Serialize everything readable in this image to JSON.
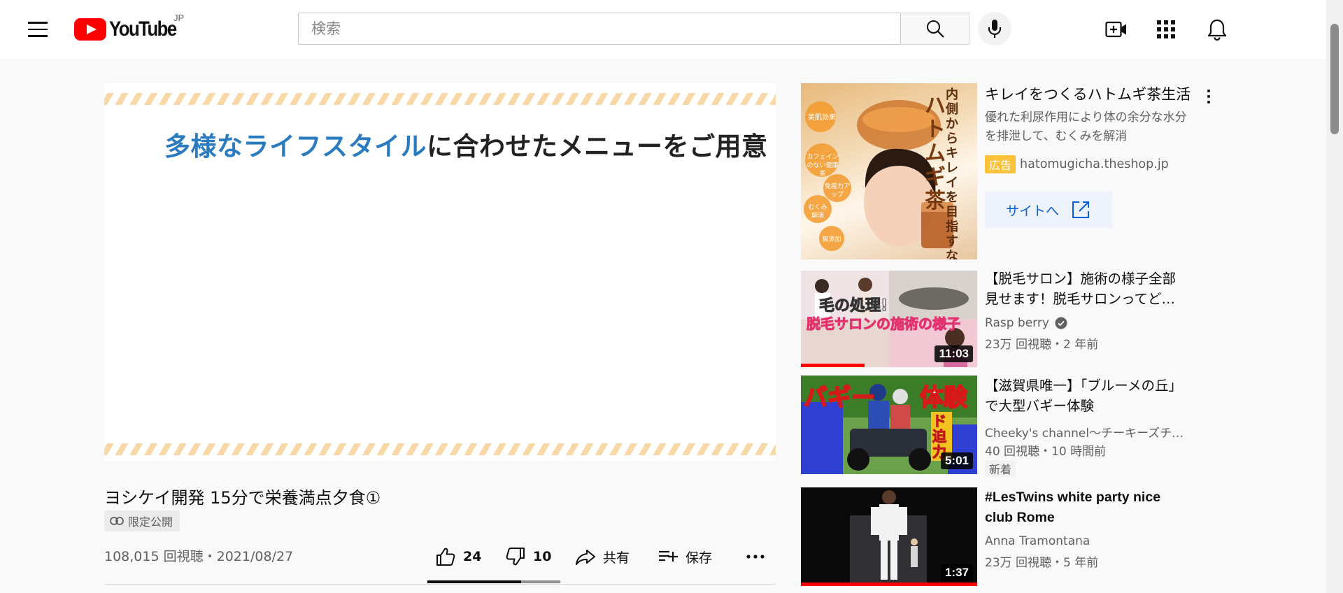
{
  "header": {
    "logo_text": "YouTube",
    "region": "JP",
    "search_placeholder": "検索",
    "icons": [
      "menu-icon",
      "search-icon",
      "microphone-icon",
      "create-video-icon",
      "apps-grid-icon",
      "notifications-bell-icon"
    ]
  },
  "player": {
    "slide_text_blue": "多様なライフスタイル",
    "slide_text_dark": "に合わせたメニューをご用意"
  },
  "video": {
    "title": "ヨシケイ開発 15分で栄養満点夕食①",
    "unlisted_label": "限定公開",
    "views_date": "108,015 回視聴・2021/08/27",
    "likes": "24",
    "dislikes": "10",
    "share_label": "共有",
    "save_label": "保存",
    "like_ratio": 0.706
  },
  "sidebar": {
    "ad": {
      "title": "キレイをつくるハトムギ茶生活",
      "description": "優れた利尿作用により体の余分な水分を排泄して、むくみを解消",
      "badge": "広告",
      "domain": "hatomugicha.theshop.jp",
      "button_label": "サイトへ",
      "thumb_text": "内側からキレイを目指すなら",
      "thumb_product": "ハトムギ茶",
      "thumb_bubbles": [
        "美肌効果",
        "カフェインのない健康茶",
        "免疫力アップ",
        "むくみ解消",
        "無添加"
      ]
    },
    "recommendations": [
      {
        "title": "【脱毛サロン】施術の様子全部見せます！脱毛サロンってど…",
        "channel": "Rasp berry",
        "verified": true,
        "meta": "23万 回視聴・2 年前",
        "duration": "11:03",
        "watched_fraction": 0.36,
        "thumb_text_1": "毛の処理!",
        "thumb_text_2": "脱毛サロンの施術の様子"
      },
      {
        "title": "【滋賀県唯一】「ブルーメの丘」で大型バギー体験",
        "channel": "Cheeky's channel〜チーキーズチャンネル〜",
        "verified": false,
        "meta": "40 回視聴・10 時間前",
        "badge": "新着",
        "duration": "5:01",
        "thumb_text_1": "バギー",
        "thumb_text_2": "体験",
        "thumb_text_3": "ド迫力"
      },
      {
        "title": "#LesTwins white party nice club Rome",
        "channel": "Anna Tramontana",
        "verified": false,
        "meta": "23万 回視聴・5 年前",
        "duration": "1:37",
        "watched_fraction": 1.0
      }
    ]
  }
}
